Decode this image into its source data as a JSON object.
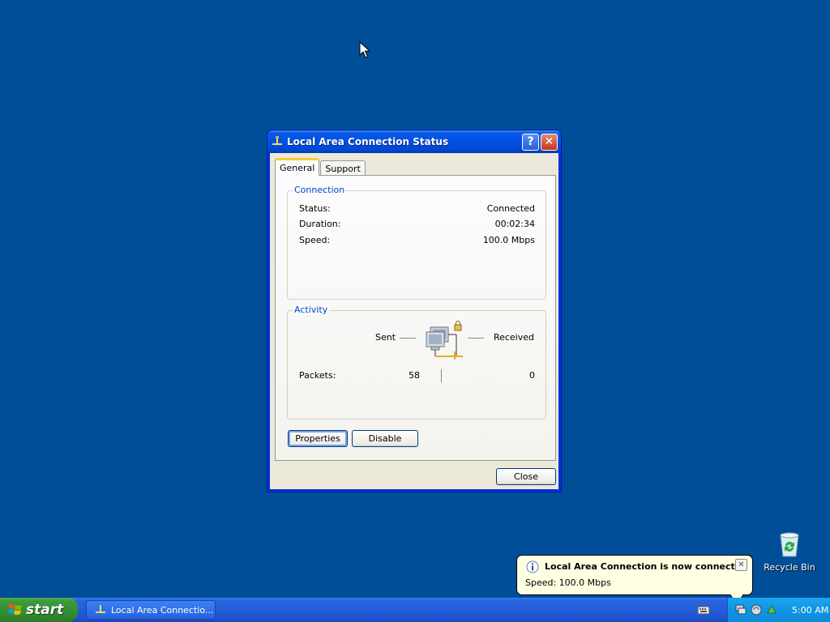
{
  "dialog": {
    "title": "Local Area Connection Status",
    "help_label": "?",
    "close_glyph": "✕",
    "tabs": [
      {
        "label": "General",
        "active": true
      },
      {
        "label": "Support",
        "active": false
      }
    ],
    "connection": {
      "legend": "Connection",
      "rows": [
        {
          "label": "Status:",
          "value": "Connected"
        },
        {
          "label": "Duration:",
          "value": "00:02:34"
        },
        {
          "label": "Speed:",
          "value": "100.0 Mbps"
        }
      ]
    },
    "activity": {
      "legend": "Activity",
      "sent_label": "Sent",
      "received_label": "Received",
      "packets_label": "Packets:",
      "packets_sent": "58",
      "packets_received": "0",
      "icon": "network-computers-icon"
    },
    "buttons": {
      "properties": "Properties",
      "disable": "Disable",
      "close": "Close"
    }
  },
  "desktop": {
    "recycle_bin_label": "Recycle Bin",
    "background_color": "#004e98"
  },
  "balloon": {
    "icon": "info-icon",
    "title": "Local Area Connection is now connected",
    "text": "Speed: 100.0 Mbps",
    "close_glyph": "✕"
  },
  "taskbar": {
    "start_label": "start",
    "task_label": "Local Area Connectio...",
    "clock": "5:00 AM",
    "tray_icons": [
      "network-tray-icon",
      "volume-tray-icon",
      "safely-remove-tray-icon"
    ]
  }
}
